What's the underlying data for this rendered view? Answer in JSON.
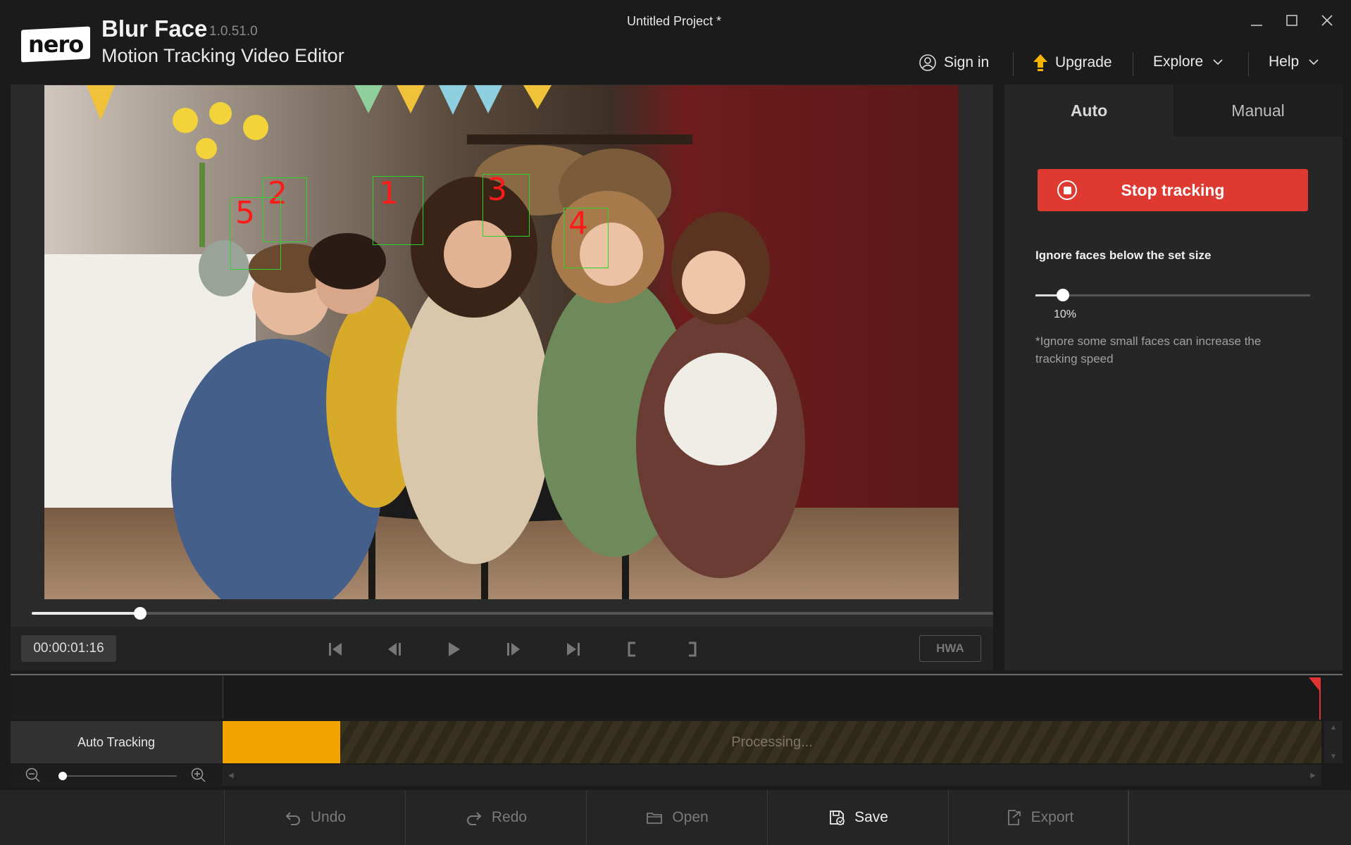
{
  "app": {
    "logo_text": "nero",
    "name": "Blur Face",
    "version": "1.0.51.0",
    "subtitle": "Motion Tracking Video Editor",
    "project_title": "Untitled Project *"
  },
  "window_controls": [
    "minimize-icon",
    "maximize-icon",
    "close-icon"
  ],
  "menu": {
    "sign_in": "Sign in",
    "upgrade": "Upgrade",
    "explore": "Explore",
    "help": "Help"
  },
  "video": {
    "face_labels": [
      "1",
      "2",
      "3",
      "4",
      "5"
    ],
    "playback_progress_fraction": 0.113,
    "timecode": "00:00:01:16",
    "hwa_label": "HWA",
    "controls": [
      "skip-to-start-icon",
      "previous-frame-icon",
      "play-icon",
      "next-frame-icon",
      "skip-to-end-icon",
      "mark-in-icon",
      "mark-out-icon"
    ]
  },
  "side_panel": {
    "tabs": [
      {
        "label": "Auto",
        "active": true
      },
      {
        "label": "Manual",
        "active": false
      }
    ],
    "stop_button": "Stop tracking",
    "ignore_label": "Ignore faces below the set size",
    "slider_value_fraction": 0.1,
    "slider_value_text": "10%",
    "hint": "*Ignore some small faces can increase the tracking speed"
  },
  "timeline": {
    "track_label": "Auto Tracking",
    "processing_text": "Processing...",
    "progress_fraction": 0.107,
    "zoom_fraction": 0.02
  },
  "toolbar": {
    "undo": "Undo",
    "redo": "Redo",
    "open": "Open",
    "save": "Save",
    "export": "Export"
  },
  "colors": {
    "accent_red": "#de3a32",
    "progress_orange": "#f3a400",
    "face_box_green": "#2bd42b",
    "upgrade_yellow": "#f5b400"
  }
}
